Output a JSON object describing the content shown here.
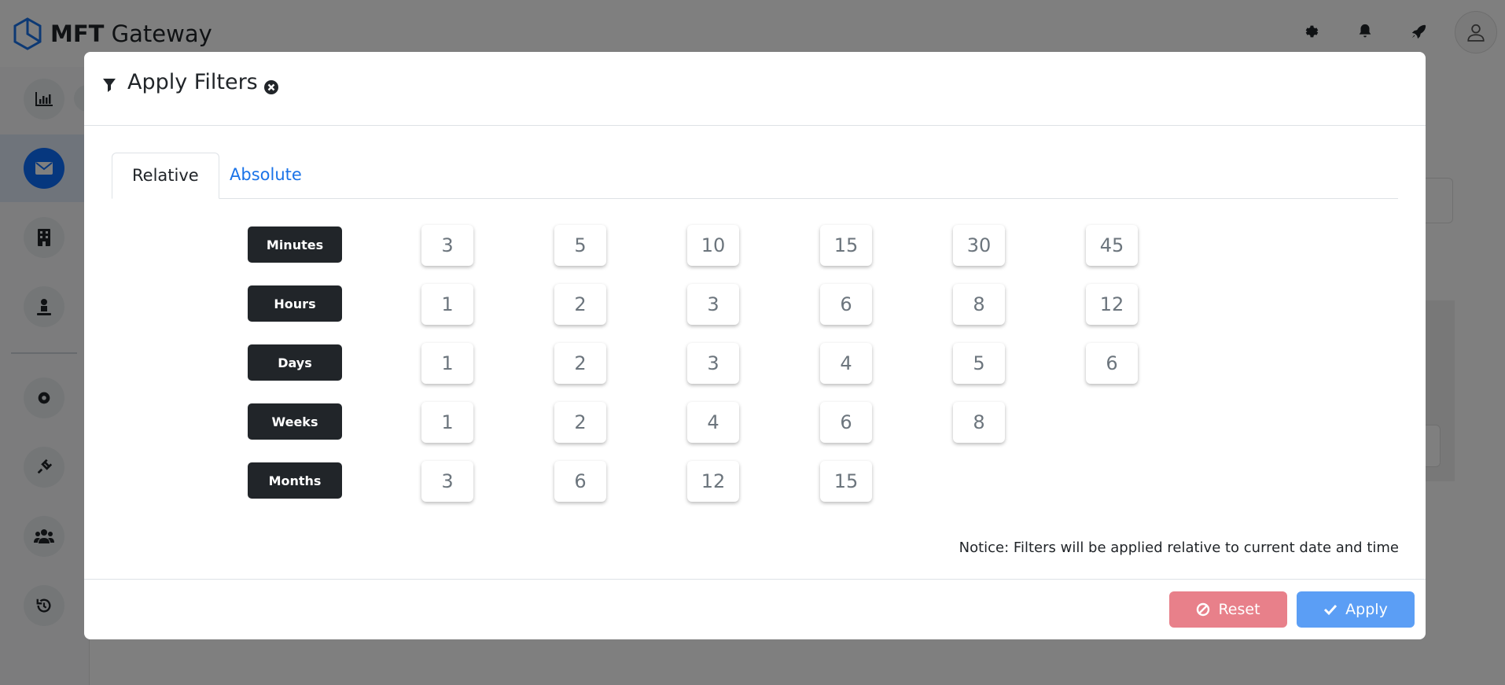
{
  "app": {
    "brand_bold": "MFT",
    "brand_regular": " Gateway"
  },
  "modal": {
    "title": "Apply Filters",
    "tabs": [
      {
        "label": "Relative",
        "active": true
      },
      {
        "label": "Absolute",
        "active": false
      }
    ],
    "rows": [
      {
        "unit": "Minutes",
        "values": [
          "3",
          "5",
          "10",
          "15",
          "30",
          "45"
        ]
      },
      {
        "unit": "Hours",
        "values": [
          "1",
          "2",
          "3",
          "6",
          "8",
          "12"
        ]
      },
      {
        "unit": "Days",
        "values": [
          "1",
          "2",
          "3",
          "4",
          "5",
          "6"
        ]
      },
      {
        "unit": "Weeks",
        "values": [
          "1",
          "2",
          "4",
          "6",
          "8"
        ]
      },
      {
        "unit": "Months",
        "values": [
          "3",
          "6",
          "12",
          "15"
        ]
      }
    ],
    "notice": "Notice: Filters will be applied relative to current date and time",
    "reset_label": "Reset",
    "apply_label": "Apply"
  },
  "colors": {
    "primary": "#0d6efd",
    "reset": "#e8808a",
    "apply": "#5b9ef5",
    "badge": "#212529"
  },
  "icons": {
    "logo": "hexagon-logo-icon",
    "settings": "gear-icon",
    "notifications": "bell-icon",
    "launch": "rocket-icon",
    "user": "user-icon",
    "filter": "filter-icon",
    "close": "close-circle-icon",
    "reset": "ban-icon",
    "apply": "check-icon"
  }
}
